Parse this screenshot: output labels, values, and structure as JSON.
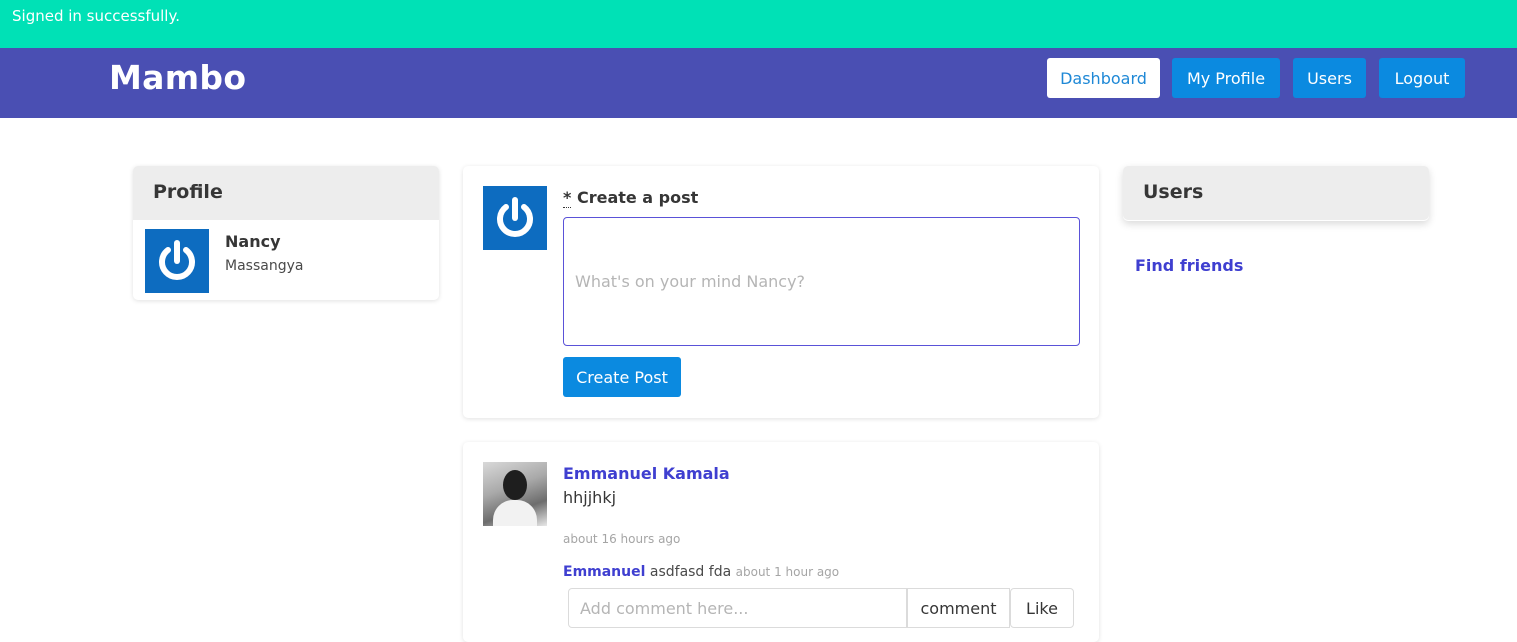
{
  "flash": {
    "message": "Signed in successfully."
  },
  "navbar": {
    "brand": "Mambo",
    "links": [
      "Dashboard",
      "My Profile",
      "Users",
      "Logout"
    ]
  },
  "profile_card": {
    "title": "Profile",
    "name": "Nancy",
    "surname": "Massangya",
    "avatar_icon": "power-icon"
  },
  "create_post": {
    "required_marker": "*",
    "label": "Create a post",
    "placeholder": "What's on your mind Nancy?",
    "button": "Create Post",
    "avatar_icon": "power-icon"
  },
  "users_card": {
    "title": "Users",
    "find_friends": "Find friends"
  },
  "post": {
    "author": "Emmanuel Kamala",
    "body": "hhjjhkj",
    "time": "about 16 hours ago",
    "comment": {
      "author": "Emmanuel",
      "text": "asdfasd fda",
      "time": "about 1 hour ago"
    },
    "comment_placeholder": "Add comment here...",
    "comment_button": "comment",
    "like_button": "Like"
  },
  "colors": {
    "flash_bg": "#00e1b6",
    "navbar_bg": "#4a4fb3",
    "primary": "#0b8ae0",
    "link": "#3f3fd0",
    "avatar_bg": "#0d6cc0"
  }
}
